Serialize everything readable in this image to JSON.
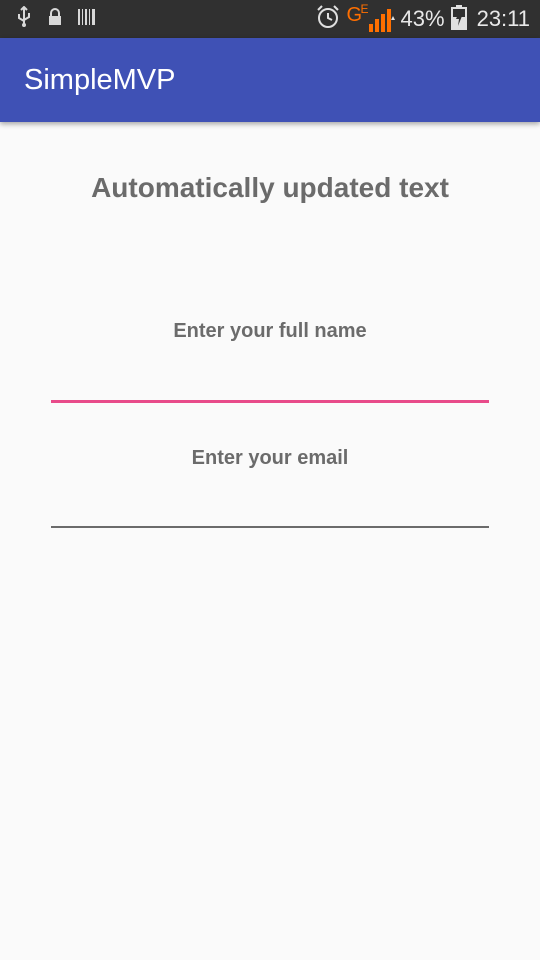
{
  "status_bar": {
    "battery_percent": "43%",
    "time": "23:11",
    "network_type": "G",
    "network_subtype": "E",
    "left_icons": [
      "usb-icon",
      "lock-icon",
      "barcode-icon"
    ],
    "right_icons": [
      "alarm-icon",
      "signal-icon",
      "battery-icon"
    ],
    "accent_color": "#ff6f00"
  },
  "app_bar": {
    "title": "SimpleMVP",
    "color": "#3f51b5"
  },
  "main": {
    "headline": "Automatically updated text",
    "name_field": {
      "label": "Enter your full name",
      "value": "",
      "focused": true,
      "underline_color": "#e84b8a"
    },
    "email_field": {
      "label": "Enter your email",
      "value": "",
      "focused": false,
      "underline_color": "#6b6b6b"
    }
  }
}
